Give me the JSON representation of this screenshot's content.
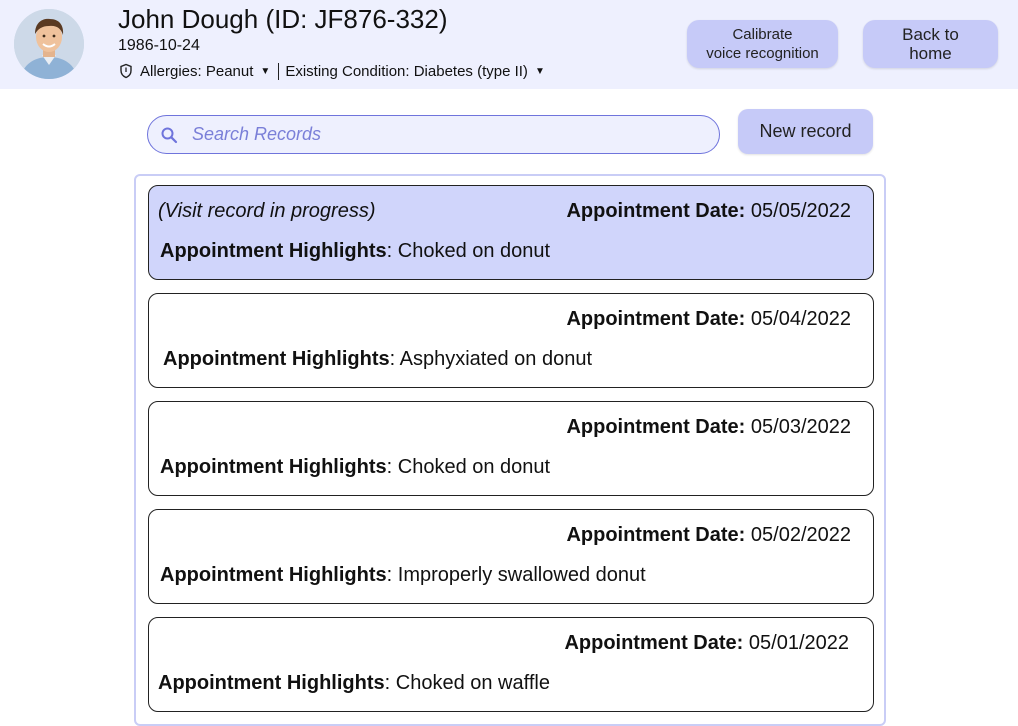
{
  "patient": {
    "name": "John Dough (ID: JF876-332)",
    "dob": "1986-10-24",
    "allergies": "Allergies: Peanut",
    "condition": "Existing Condition: Diabetes (type II)"
  },
  "header": {
    "calibrate_label": "Calibrate\nvoice recognition",
    "home_label": "Back to\nhome"
  },
  "search": {
    "placeholder": "Search Records"
  },
  "actions": {
    "new_record_label": "New record"
  },
  "records": {
    "date_label": "Appointment Date:",
    "highlights_label": "Appointment Highlights",
    "items": [
      {
        "status": "(Visit record in progress)",
        "date": "05/05/2022",
        "highlight": "Choked on donut"
      },
      {
        "status": "",
        "date": "05/04/2022",
        "highlight": "Asphyxiated on donut"
      },
      {
        "status": "",
        "date": "05/03/2022",
        "highlight": "Choked on donut"
      },
      {
        "status": "",
        "date": "05/02/2022",
        "highlight": "Improperly swallowed donut"
      },
      {
        "status": "",
        "date": "05/01/2022",
        "highlight": "Choked on waffle"
      }
    ]
  },
  "colors": {
    "header_bg": "#eef0fe",
    "button_bg": "#c6caf8",
    "accent": "#6f74dc",
    "active_record_bg": "#d0d5fb"
  },
  "icons": {
    "allergy": "shield-icon",
    "search": "search-icon",
    "dropdown": "caret-down-icon"
  }
}
